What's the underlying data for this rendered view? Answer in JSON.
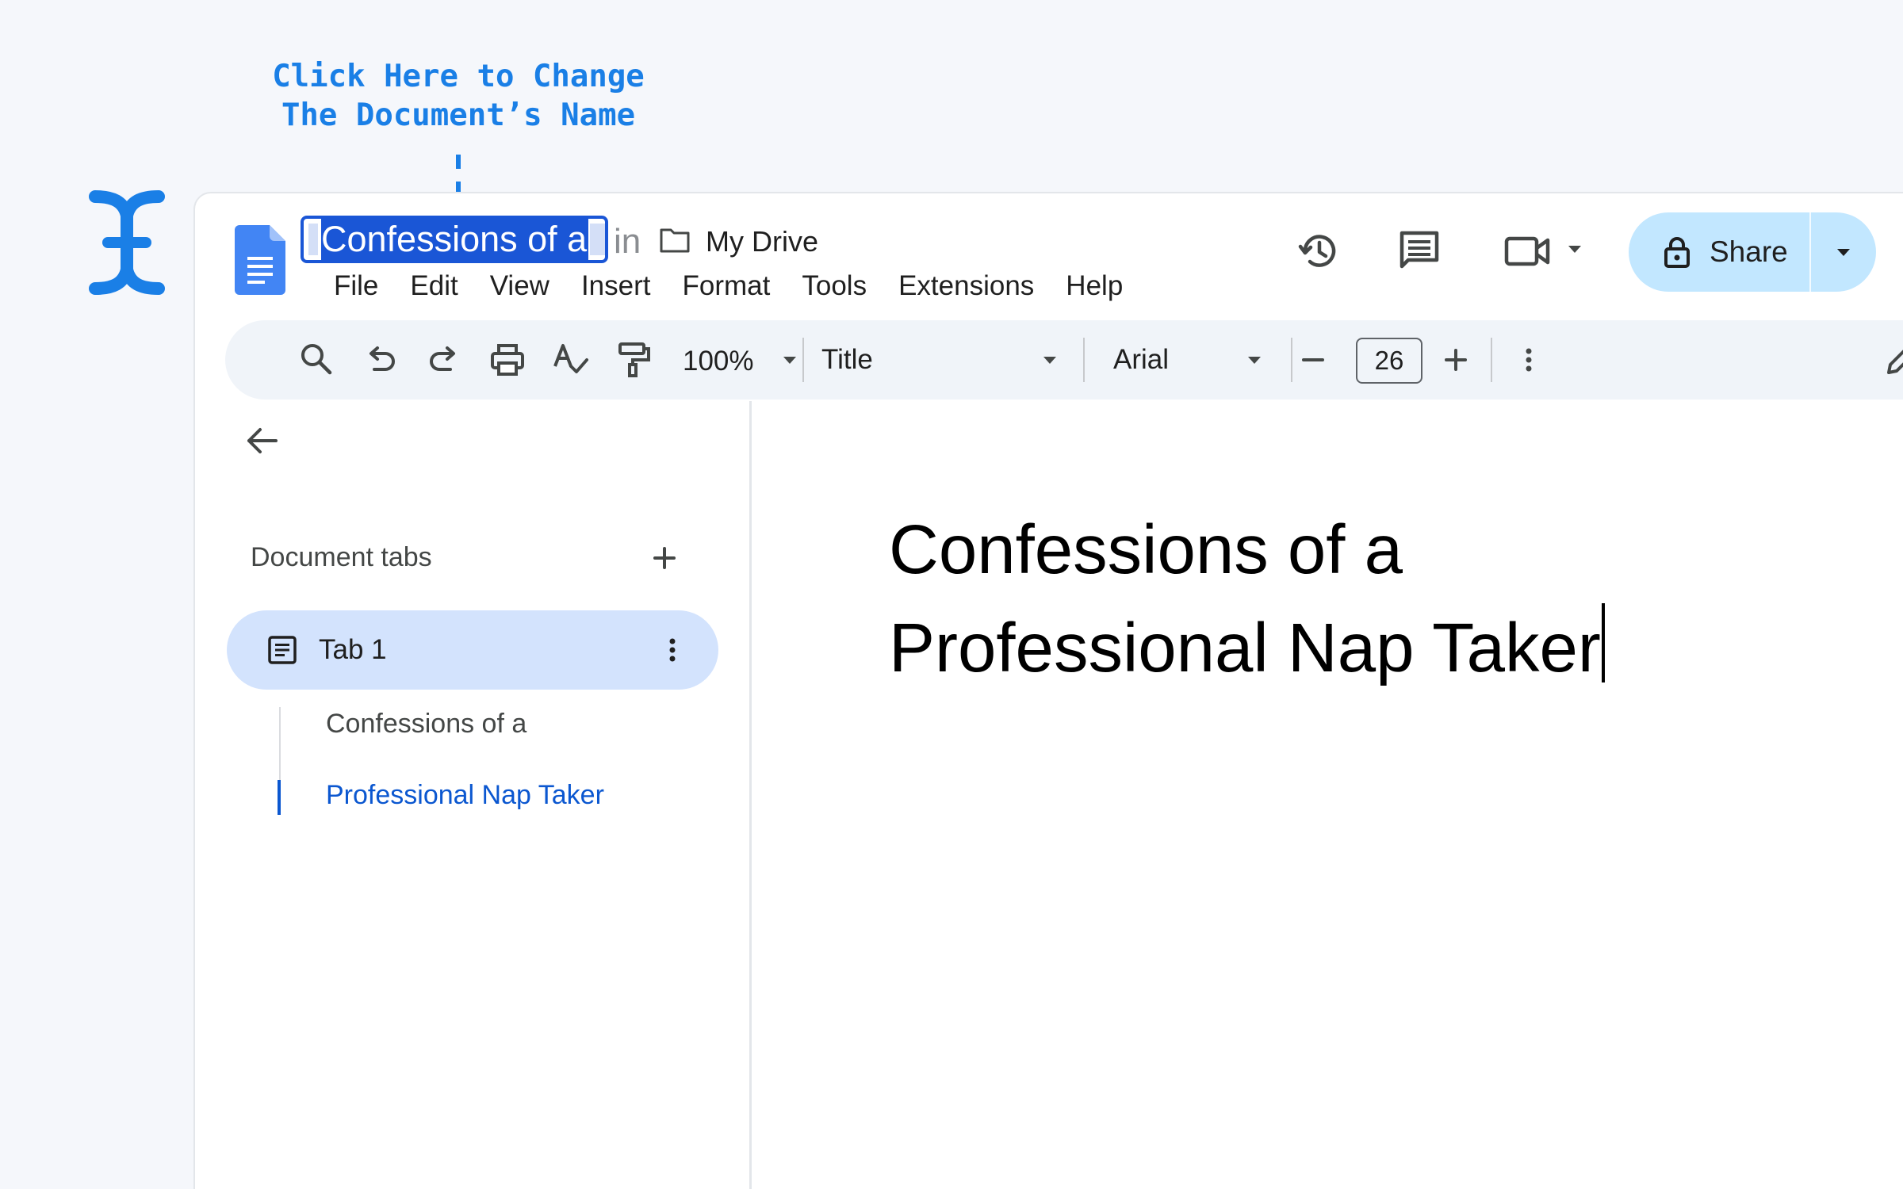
{
  "annotation": {
    "line1": "Click Here to Change",
    "line2": "The Document’s Name"
  },
  "header": {
    "doc_title": "Confessions of a",
    "in_label": "in",
    "location": "My Drive",
    "share_label": "Share"
  },
  "menu": [
    "File",
    "Edit",
    "View",
    "Insert",
    "Format",
    "Tools",
    "Extensions",
    "Help"
  ],
  "toolbar": {
    "zoom": "100%",
    "style": "Title",
    "font": "Arial",
    "font_size": "26"
  },
  "sidebar": {
    "heading": "Document tabs",
    "tab_label": "Tab 1",
    "outline": [
      "Confessions of a",
      "Professional Nap Taker"
    ]
  },
  "document": {
    "title_line1": "Confessions of a",
    "title_line2": "Professional Nap Taker"
  },
  "colors": {
    "accent": "#1a7fe6",
    "selection": "#1a56d6",
    "share_bg": "#c2e7ff",
    "tab_active_bg": "#d3e3fd",
    "outline_active": "#0b57d0"
  }
}
